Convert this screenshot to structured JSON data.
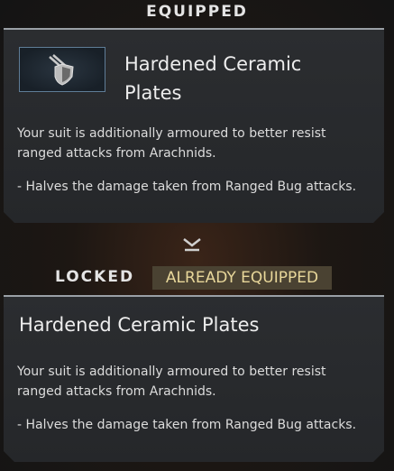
{
  "equipped_header": "EQUIPPED",
  "equipped_card": {
    "icon": "shield-with-swords-icon",
    "title_line1": "Hardened Ceramic",
    "title_line2": "Plates",
    "description_line1": "Your suit is additionally armoured to better resist",
    "description_line2": "ranged attacks from Arachnids.",
    "bullet": "- Halves the damage taken from Ranged Bug attacks."
  },
  "divider_icon": "chevron-down-icon",
  "locked_row": {
    "label": "LOCKED",
    "badge": "ALREADY EQUIPPED"
  },
  "locked_card": {
    "title": "Hardened Ceramic Plates",
    "description_line1": "Your suit is additionally armoured to better resist",
    "description_line2": "ranged attacks from Arachnids.",
    "bullet": "- Halves the damage taken from Ranged Bug attacks."
  },
  "colors": {
    "card_bg": "#2b2d30",
    "badge_bg": "#4a4232",
    "badge_text": "#e8d79a",
    "icon_border": "#5f7d97"
  }
}
